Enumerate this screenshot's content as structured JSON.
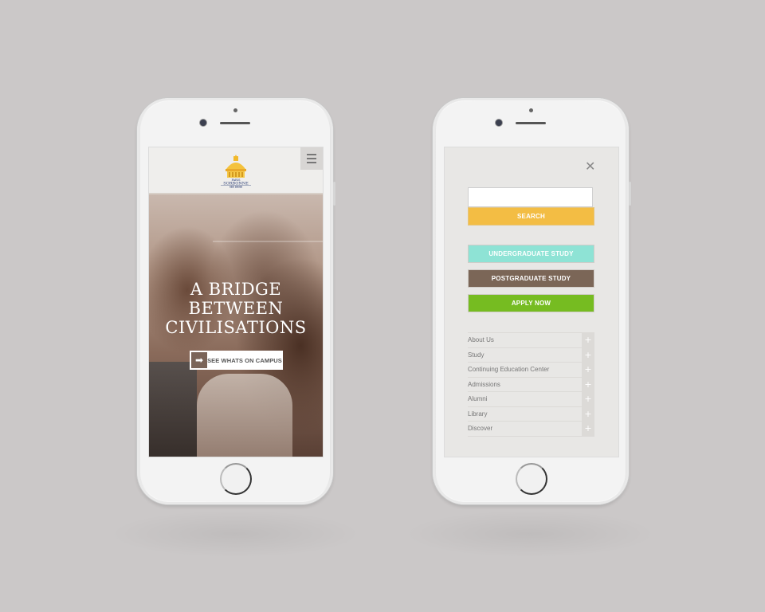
{
  "left_phone": {
    "header": {
      "logo": {
        "icon": "university-dome-logo",
        "line1": "UNIVERSITÉ",
        "line2": "PARIS",
        "line3": "SORBONNE",
        "line4": "ABU DHABI"
      },
      "menu_icon": "hamburger-icon"
    },
    "hero": {
      "title_lines": [
        "A BRIDGE",
        "BETWEEN",
        "CIVILISATIONS"
      ],
      "cta": {
        "icon": "arrow-right-icon",
        "label": "SEE WHATS ON CAMPUS"
      }
    }
  },
  "right_phone": {
    "close_icon": "close-icon",
    "search": {
      "placeholder": "",
      "value": "",
      "button_label": "SEARCH"
    },
    "buttons": [
      {
        "label": "UNDERGRADUATE STUDY",
        "color": "#8ee3d5"
      },
      {
        "label": "POSTGRADUATE STUDY",
        "color": "#7b6657"
      },
      {
        "label": "APPLY NOW",
        "color": "#76bc21"
      }
    ],
    "search_color": "#f3bd44",
    "nav_items": [
      {
        "label": "About Us",
        "icon": "plus-icon"
      },
      {
        "label": "Study",
        "icon": "plus-icon"
      },
      {
        "label": "Continuing Education Center",
        "icon": "plus-icon"
      },
      {
        "label": "Admissions",
        "icon": "plus-icon"
      },
      {
        "label": "Alumni",
        "icon": "plus-icon"
      },
      {
        "label": "Library",
        "icon": "plus-icon"
      },
      {
        "label": "Discover",
        "icon": "plus-icon"
      }
    ]
  }
}
